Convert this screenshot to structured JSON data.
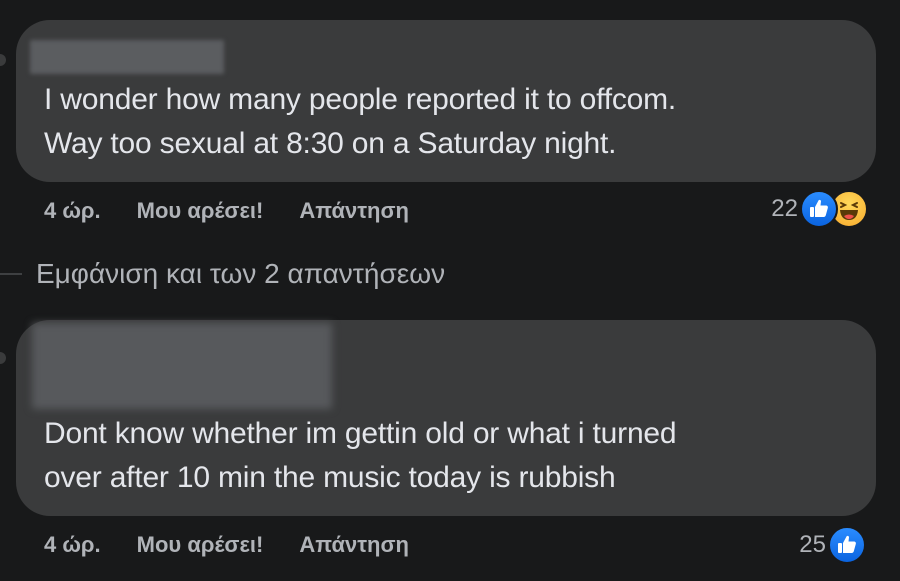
{
  "comments": [
    {
      "text": "I wonder how many people reported it to offcom.\nWay too sexual at 8:30 on a Saturday night.",
      "time": "4 ώρ.",
      "like_label": "Μου αρέσει!",
      "reply_label": "Απάντηση",
      "reaction_count": "22",
      "reactions": [
        "like-icon",
        "haha-icon"
      ]
    },
    {
      "text": "Dont know whether im gettin old or what i turned\nover after 10 min the music today is rubbish",
      "time": "4 ώρ.",
      "like_label": "Μου αρέσει!",
      "reply_label": "Απάντηση",
      "reaction_count": "25",
      "reactions": [
        "like-icon"
      ]
    }
  ],
  "view_replies_label": "Εμφάνιση και των 2 απαντήσεων",
  "colors": {
    "background": "#18191a",
    "bubble": "#3a3b3c",
    "text_primary": "#e4e6eb",
    "text_secondary": "#b0b3b8",
    "like_blue": "#1877f2",
    "haha_yellow": "#f7b928"
  }
}
